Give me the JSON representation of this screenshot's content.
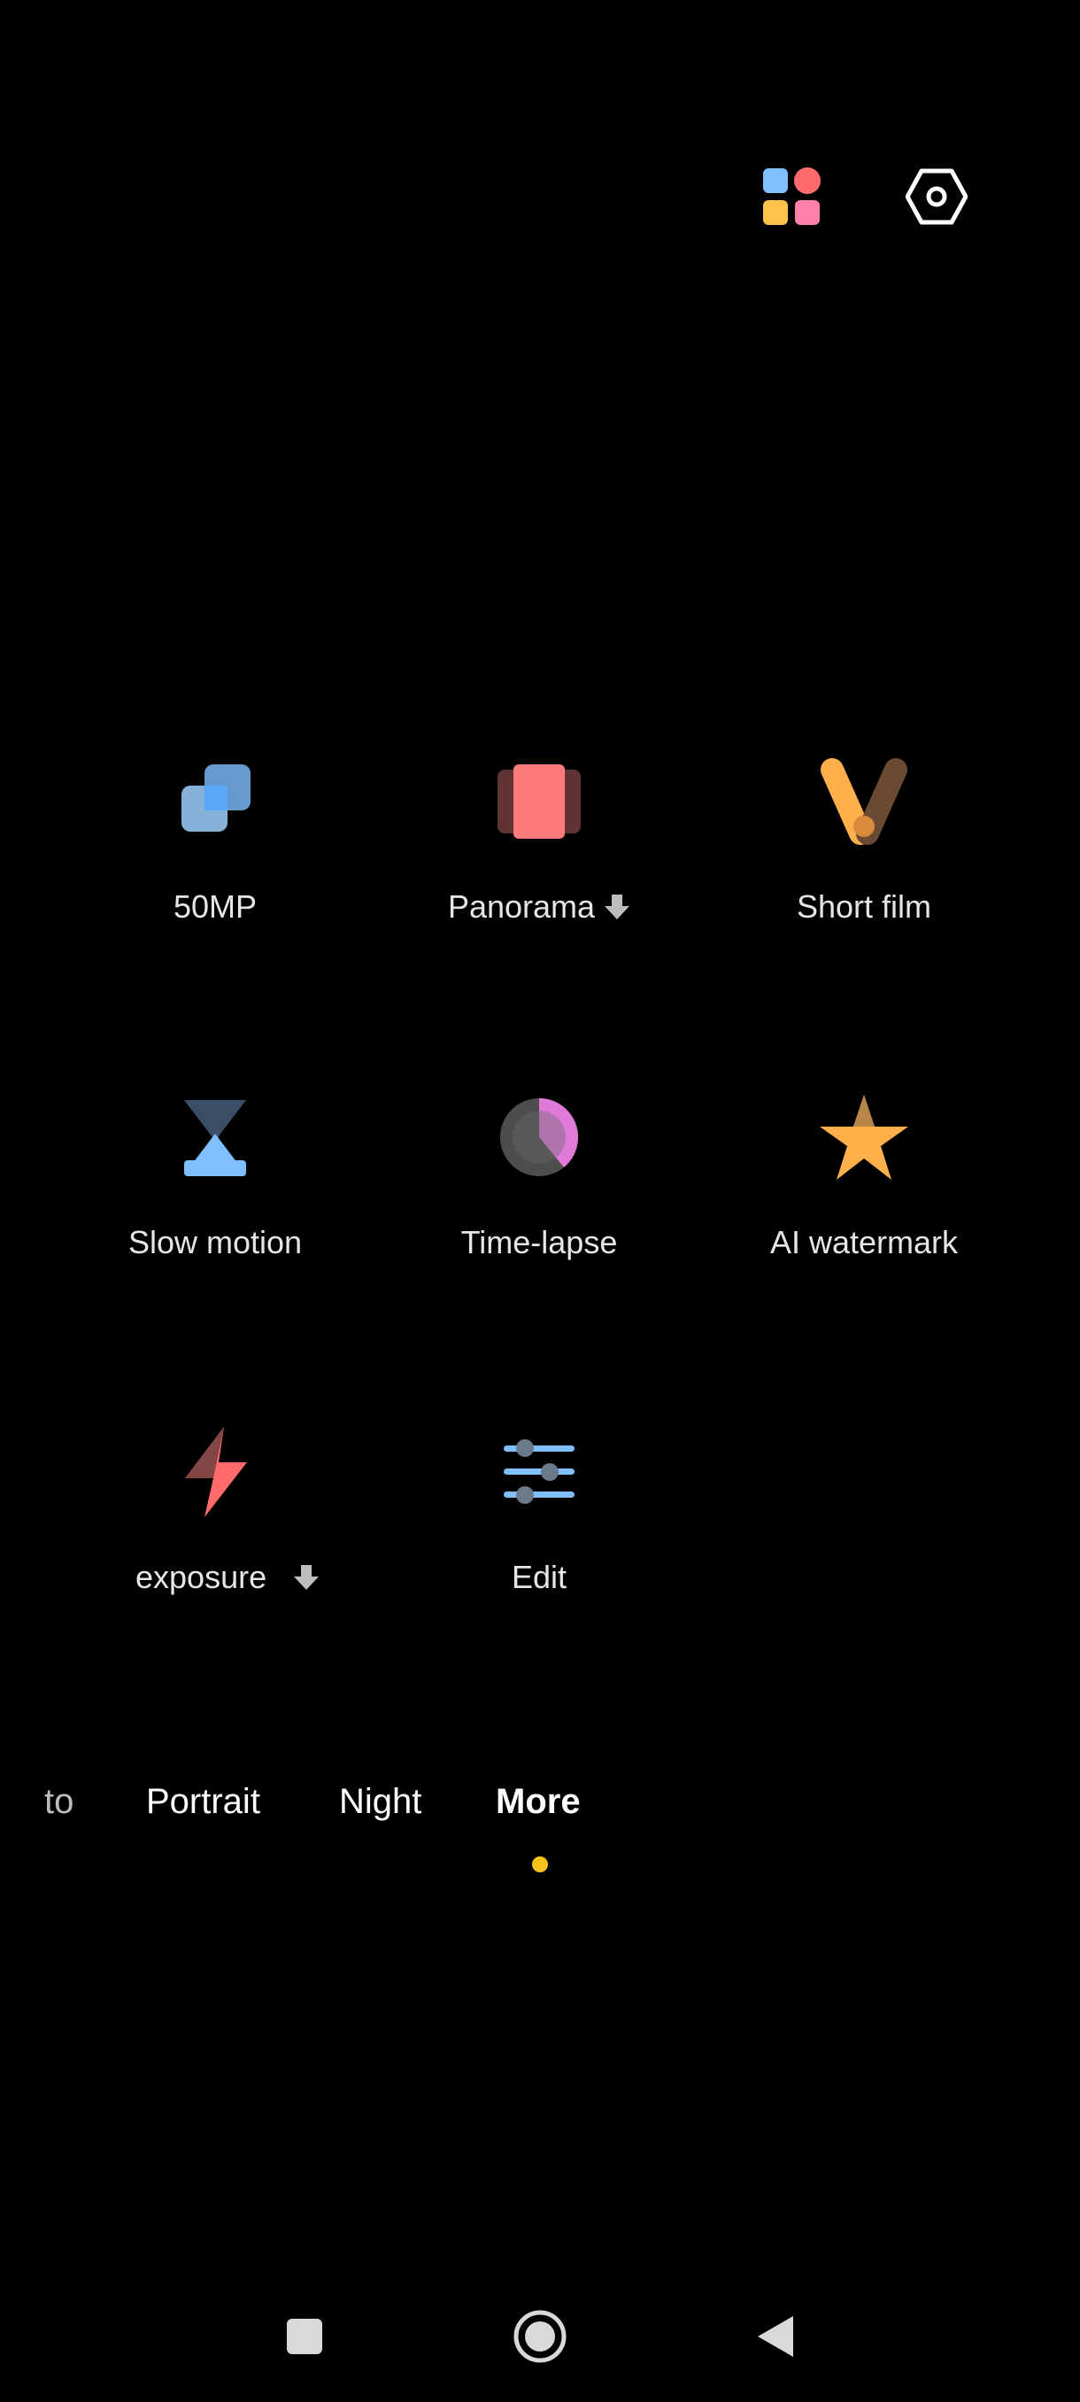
{
  "top_bar": {
    "grid_icon": "apps-grid-icon",
    "settings_icon": "settings-hexagon-icon"
  },
  "modes": [
    {
      "id": "50mp",
      "label": "50MP",
      "icon": "50mp-icon",
      "download": false
    },
    {
      "id": "panorama",
      "label": "Panorama",
      "icon": "panorama-icon",
      "download": true
    },
    {
      "id": "short-film",
      "label": "Short film",
      "icon": "short-film-icon",
      "download": false
    },
    {
      "id": "slow-motion",
      "label": "Slow motion",
      "icon": "slow-motion-icon",
      "download": false
    },
    {
      "id": "time-lapse",
      "label": "Time-lapse",
      "icon": "time-lapse-icon",
      "download": false
    },
    {
      "id": "ai-watermark",
      "label": "AI watermark",
      "icon": "ai-watermark-icon",
      "download": false
    },
    {
      "id": "long-exposure",
      "label": "exposure",
      "icon": "long-exposure-icon",
      "download": true
    },
    {
      "id": "edit",
      "label": "Edit",
      "icon": "edit-sliders-icon",
      "download": false
    }
  ],
  "mode_strip": {
    "tabs": [
      {
        "label": "to",
        "partial": true
      },
      {
        "label": "Portrait"
      },
      {
        "label": "Night"
      },
      {
        "label": "More",
        "active": true
      }
    ],
    "indicator_color": "#f7c31b"
  },
  "nav_bar": {
    "recent_icon": "recent-apps-icon",
    "home_icon": "home-icon",
    "back_icon": "back-icon"
  },
  "colors": {
    "background": "#000000",
    "text": "#e6e6e6",
    "accent_yellow": "#f7c31b",
    "blue": "#7fbfff",
    "red": "#ff6b6b",
    "orange": "#ffb04a",
    "pink": "#ff7fa8"
  }
}
